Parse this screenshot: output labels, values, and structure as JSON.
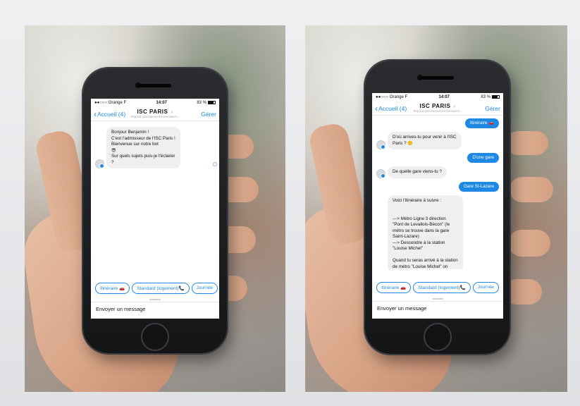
{
  "colors": {
    "accent": "#1e88e5",
    "bot_bubble": "#efefef",
    "phone_body": "#1b1c1f"
  },
  "phones": [
    {
      "status": {
        "carrier": "●●○○○ Orange F",
        "time": "14:07",
        "battery": "83 %"
      },
      "nav": {
        "back_label": "Accueil (4)",
        "title": "ISC PARIS",
        "subtitle": "Répond généralement immédiatem...",
        "manage_label": "Gérer"
      },
      "messages": [
        {
          "from": "bot",
          "text": "Bonjour Benjamin !\nC'est l'admisseur de l'ISC Paris !\nBienvenue sur notre bot\n😎\nSur quels sujets puis-je t'éclairer\n?"
        }
      ],
      "quick_replies": [
        "Itinéraire 🚗",
        "Standard (logement)📞",
        "Journée"
      ],
      "composer_placeholder": "Envoyer un message"
    },
    {
      "status": {
        "carrier": "●●○○○ Orange F",
        "time": "14:07",
        "battery": "83 %"
      },
      "nav": {
        "back_label": "Accueil (4)",
        "title": "ISC PARIS",
        "subtitle": "Répond généralement immédiatem...",
        "manage_label": "Gérer"
      },
      "messages": [
        {
          "from": "user",
          "text": "Itinéraire 🚗"
        },
        {
          "from": "bot",
          "text": "D'où arrives-tu pour venir à l'ISC\nParis ? 🙂"
        },
        {
          "from": "user",
          "text": "D'une gare"
        },
        {
          "from": "bot",
          "text": "De quelle gare viens-tu ?"
        },
        {
          "from": "user",
          "text": "Gare St-Lazare"
        },
        {
          "from": "bot",
          "text": "Voici l'itinéraire à suivre :\n\n\n---> Métro Ligne 3 direction\n\"Pont de Levallois-Bécon\" (le\nmétro se trouve dans la gare\nSaint-Lazare)\n---> Descendre à la station\n\"Louise Michel\"\n\nQuand tu seras arrivé à la station\nde métro \"Louise Michel\" on\nviendra te chercher !"
        }
      ],
      "quick_replies": [
        "Itinéraire 🚗",
        "Standard (logement)📞",
        "Journée"
      ],
      "composer_placeholder": "Envoyer un message"
    }
  ]
}
